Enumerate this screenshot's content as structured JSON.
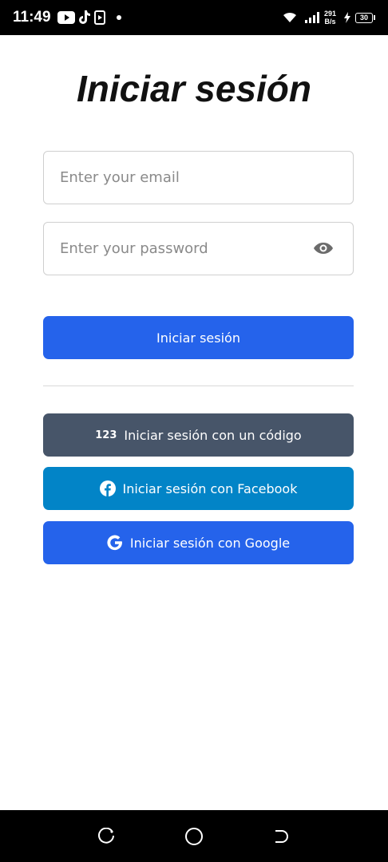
{
  "status_bar": {
    "time": "11:49",
    "net_speed_value": "291",
    "net_speed_unit": "B/s",
    "battery": "30"
  },
  "login": {
    "title": "Iniciar sesión",
    "email_placeholder": "Enter your email",
    "password_placeholder": "Enter your password",
    "submit_label": "Iniciar sesión",
    "code_label": "Iniciar sesión con un código",
    "code_icon_text": "123",
    "facebook_label": "Iniciar sesión con Facebook",
    "google_label": "Iniciar sesión con Google"
  },
  "colors": {
    "primary": "#2563EB",
    "code_button": "#475569",
    "facebook_button": "#0284C7",
    "google_button": "#2563EB"
  },
  "icons": [
    "youtube-icon",
    "tiktok-icon",
    "media-icon",
    "wifi-icon",
    "signal-icon",
    "charging-icon",
    "eye-icon",
    "facebook-icon",
    "google-icon",
    "recent-apps-icon",
    "home-icon",
    "back-icon"
  ]
}
